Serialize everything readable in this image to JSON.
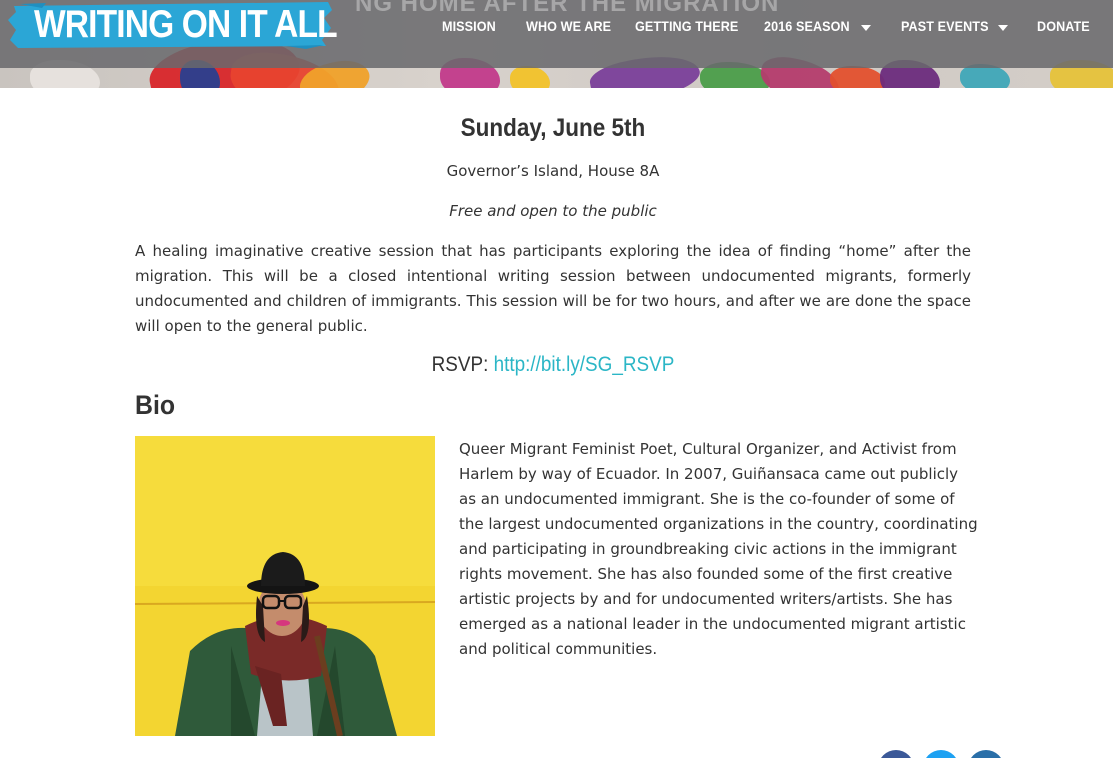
{
  "header": {
    "logo_text": "WRITING ON IT ALL",
    "hero_title_fragment": "NG HOME AFTER THE MIGRATION",
    "nav": [
      {
        "label": "MISSION",
        "has_dropdown": false
      },
      {
        "label": "WHO WE ARE",
        "has_dropdown": false
      },
      {
        "label": "GETTING THERE",
        "has_dropdown": false
      },
      {
        "label": "2016 SEASON",
        "has_dropdown": true
      },
      {
        "label": "PAST EVENTS",
        "has_dropdown": true
      },
      {
        "label": "DONATE",
        "has_dropdown": false
      }
    ]
  },
  "event": {
    "date": "Sunday, June 5th",
    "location": "Governor’s Island, House 8A",
    "admission": "Free and open to the public",
    "description": "A healing imaginative creative session that has participants exploring the idea of finding “home” after the migration. This will be a closed intentional writing session between undocumented migrants, formerly undocumented and children of immigrants. This session will be for two hours, and after we are done the space will open to the general public.",
    "rsvp_label": "RSVP:",
    "rsvp_link": "http://bit.ly/SG_RSVP"
  },
  "bio": {
    "heading": "Bio",
    "text": "Queer Migrant Feminist Poet, Cultural Organizer, and Activist from Harlem by way of Ecuador. In 2007, Guiñansaca came out publicly as an undocumented immigrant. She is the co-founder of some of the largest undocumented organizations in the country, coordinating and participating in groundbreaking civic actions in the immigrant rights movement. She has also founded some of the first creative artistic projects by and for undocumented writers/artists. She has emerged as a national leader in the undocumented migrant artistic and political communities."
  },
  "share": [
    {
      "icon": "facebook-icon",
      "color": "#3b5998"
    },
    {
      "icon": "twitter-icon",
      "color": "#1da1f2"
    },
    {
      "icon": "linkedin-icon",
      "color": "#2a6fa8"
    }
  ],
  "colors": {
    "accent_link": "#2bb6c6",
    "logo_banner": "#2ba6d6",
    "navbar": "#69696c"
  }
}
